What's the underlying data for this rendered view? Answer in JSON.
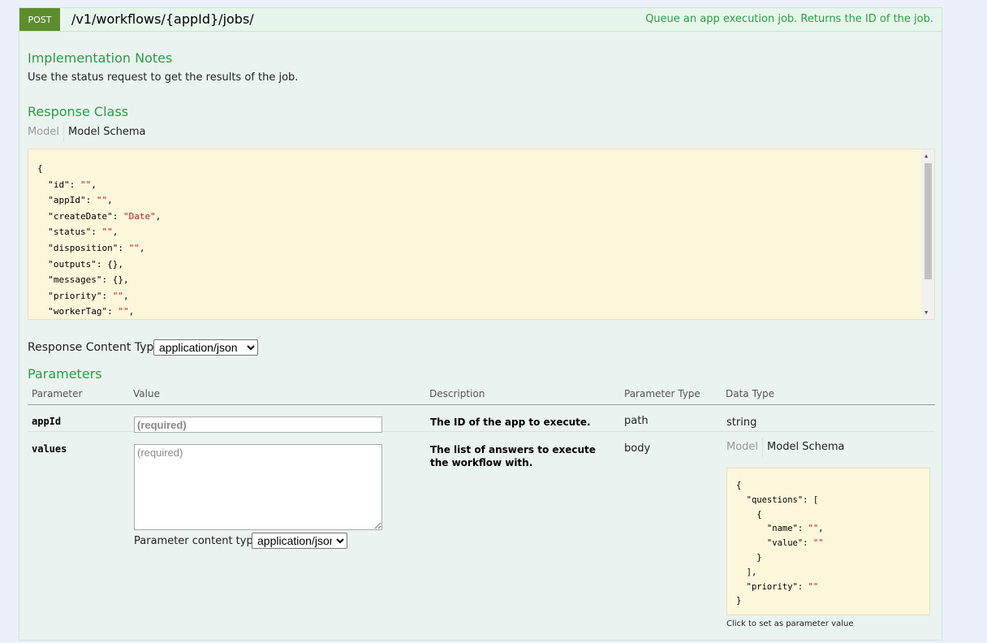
{
  "operation": {
    "method": "POST",
    "path": "/v1/workflows/{appId}/jobs/",
    "summary": "Queue an app execution job. Returns the ID of the job."
  },
  "implementation_notes": {
    "title": "Implementation Notes",
    "text": "Use the status request to get the results of the job."
  },
  "response_class": {
    "title": "Response Class",
    "tab_model": "Model",
    "tab_schema": "Model Schema",
    "schema_lines": [
      {
        "key": "{",
        "val": "",
        "tail": ""
      },
      {
        "key": "  \"id\": ",
        "val": "\"\"",
        "tail": ","
      },
      {
        "key": "  \"appId\": ",
        "val": "\"\"",
        "tail": ","
      },
      {
        "key": "  \"createDate\": ",
        "val": "\"Date\"",
        "tail": ","
      },
      {
        "key": "  \"status\": ",
        "val": "\"\"",
        "tail": ","
      },
      {
        "key": "  \"disposition\": ",
        "val": "\"\"",
        "tail": ","
      },
      {
        "key": "  \"outputs\": {},",
        "val": "",
        "tail": ""
      },
      {
        "key": "  \"messages\": {},",
        "val": "",
        "tail": ""
      },
      {
        "key": "  \"priority\": ",
        "val": "\"\"",
        "tail": ","
      },
      {
        "key": "  \"workerTag\": ",
        "val": "\"\"",
        "tail": ","
      }
    ]
  },
  "response_content_type": {
    "label": "Response Content Type",
    "selected": "application/json"
  },
  "parameters": {
    "title": "Parameters",
    "headers": {
      "parameter": "Parameter",
      "value": "Value",
      "description": "Description",
      "parameter_type": "Parameter Type",
      "data_type": "Data Type"
    },
    "rows": [
      {
        "name": "appId",
        "placeholder": "(required)",
        "description": "The ID of the app to execute.",
        "param_type": "path",
        "data_type": "string"
      },
      {
        "name": "values",
        "placeholder": "(required)",
        "description": "The list of answers to execute the workflow with.",
        "param_type": "body",
        "content_type_label": "Parameter content type:",
        "content_type_selected": "application/json",
        "tab_model": "Model",
        "tab_schema": "Model Schema",
        "schema_lines": [
          {
            "key": "{",
            "val": "",
            "tail": ""
          },
          {
            "key": "  \"questions\": [",
            "val": "",
            "tail": ""
          },
          {
            "key": "    {",
            "val": "",
            "tail": ""
          },
          {
            "key": "      \"name\": ",
            "val": "\"\"",
            "tail": ","
          },
          {
            "key": "      \"value\": ",
            "val": "\"\"",
            "tail": ""
          },
          {
            "key": "    }",
            "val": "",
            "tail": ""
          },
          {
            "key": "  ],",
            "val": "",
            "tail": ""
          },
          {
            "key": "  \"priority\": ",
            "val": "\"\"",
            "tail": ""
          },
          {
            "key": "}",
            "val": "",
            "tail": ""
          }
        ],
        "click_hint": "Click to set as parameter value"
      }
    ]
  }
}
